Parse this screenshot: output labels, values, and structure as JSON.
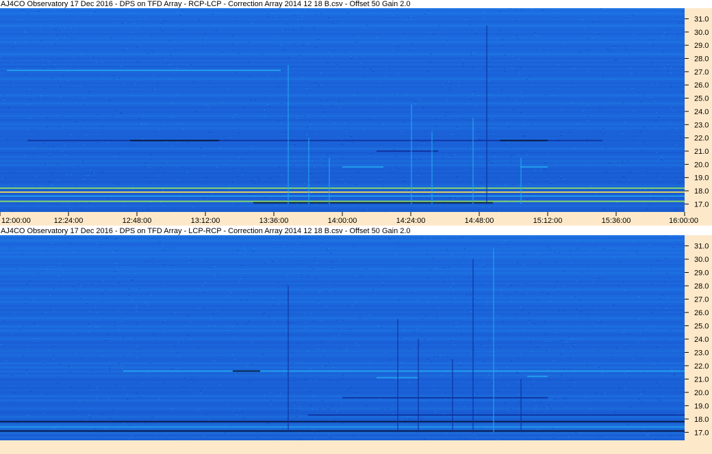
{
  "window": {
    "background": "#ffffff",
    "axis_background": "#fde9c9"
  },
  "colors": {
    "plot_base_top": "#1c6ae0",
    "plot_base_bottom": "#1a5fd6",
    "band_dark": "#0d2f9c",
    "band_light": "#24a8f0",
    "hot_green": "#9cf25a",
    "hot_yellow": "#ffe14a",
    "cold_black": "#061030"
  },
  "chart_data": [
    {
      "type": "heatmap",
      "title": "AJ4CO Observatory 17 Dec 2016  -  DPS on TFD Array  -  RCP-LCP  -  Correction Array 2014 12 18 B.csv  -  Offset 50  Gain 2.0",
      "xlabel": "",
      "ylabel": "",
      "x_ticks": [
        "12:00:00",
        "12:24:00",
        "12:48:00",
        "13:12:00",
        "13:36:00",
        "14:00:00",
        "14:24:00",
        "14:48:00",
        "15:12:00",
        "15:36:00",
        "16:00:00"
      ],
      "y_ticks": [
        "31.0",
        "30.0",
        "29.0",
        "28.0",
        "27.0",
        "26.0",
        "25.0",
        "24.0",
        "23.0",
        "22.0",
        "21.0",
        "20.0",
        "19.0",
        "18.0",
        "17.0"
      ],
      "xlim": [
        "12:00:00",
        "16:00:00"
      ],
      "ylim": [
        16.4,
        31.8
      ],
      "features": [
        {
          "kind": "hline",
          "freq": 21.8,
          "t0": 0.04,
          "t1": 0.88,
          "tone": "dark"
        },
        {
          "kind": "hline",
          "freq": 21.8,
          "t0": 0.19,
          "t1": 0.32,
          "tone": "cold"
        },
        {
          "kind": "hline",
          "freq": 21.8,
          "t0": 0.73,
          "t1": 0.8,
          "tone": "cold"
        },
        {
          "kind": "hline",
          "freq": 21.0,
          "t0": 0.55,
          "t1": 0.64,
          "tone": "dark"
        },
        {
          "kind": "hline",
          "freq": 19.8,
          "t0": 0.5,
          "t1": 0.56,
          "tone": "light"
        },
        {
          "kind": "hline",
          "freq": 19.8,
          "t0": 0.76,
          "t1": 0.8,
          "tone": "light"
        },
        {
          "kind": "hline",
          "freq": 18.2,
          "t0": 0.0,
          "t1": 1.0,
          "tone": "green"
        },
        {
          "kind": "hline",
          "freq": 17.9,
          "t0": 0.0,
          "t1": 1.0,
          "tone": "yellow"
        },
        {
          "kind": "hline",
          "freq": 17.6,
          "t0": 0.0,
          "t1": 1.0,
          "tone": "light"
        },
        {
          "kind": "hline",
          "freq": 17.2,
          "t0": 0.0,
          "t1": 1.0,
          "tone": "green"
        },
        {
          "kind": "hline",
          "freq": 17.1,
          "t0": 0.37,
          "t1": 0.72,
          "tone": "cold"
        },
        {
          "kind": "hline",
          "freq": 27.1,
          "t0": 0.01,
          "t1": 0.41,
          "tone": "light"
        },
        {
          "kind": "vburst",
          "t": 0.42,
          "f0": 17.0,
          "f1": 27.5,
          "tone": "light"
        },
        {
          "kind": "vburst",
          "t": 0.45,
          "f0": 17.0,
          "f1": 22.0,
          "tone": "light"
        },
        {
          "kind": "vburst",
          "t": 0.48,
          "f0": 17.0,
          "f1": 20.5,
          "tone": "light"
        },
        {
          "kind": "vburst",
          "t": 0.6,
          "f0": 17.0,
          "f1": 24.5,
          "tone": "light"
        },
        {
          "kind": "vburst",
          "t": 0.63,
          "f0": 17.0,
          "f1": 22.5,
          "tone": "light"
        },
        {
          "kind": "vburst",
          "t": 0.69,
          "f0": 17.0,
          "f1": 23.5,
          "tone": "light"
        },
        {
          "kind": "vburst",
          "t": 0.71,
          "f0": 17.0,
          "f1": 30.5,
          "tone": "dark"
        },
        {
          "kind": "vburst",
          "t": 0.76,
          "f0": 17.0,
          "f1": 20.5,
          "tone": "light"
        }
      ]
    },
    {
      "type": "heatmap",
      "title": "AJ4CO Observatory 17 Dec 2016  -  DPS on TFD Array  -  LCP-RCP  -  Correction Array 2014 12 18 B.csv  -  Offset 50  Gain 2.0",
      "xlabel": "",
      "ylabel": "",
      "x_ticks": [],
      "y_ticks": [
        "31.0",
        "30.0",
        "29.0",
        "28.0",
        "27.0",
        "26.0",
        "25.0",
        "24.0",
        "23.0",
        "22.0",
        "21.0",
        "20.0",
        "19.0",
        "18.0",
        "17.0"
      ],
      "xlim": [
        "12:00:00",
        "16:00:00"
      ],
      "ylim": [
        16.4,
        31.8
      ],
      "features": [
        {
          "kind": "hline",
          "freq": 21.6,
          "t0": 0.18,
          "t1": 1.0,
          "tone": "light"
        },
        {
          "kind": "hline",
          "freq": 21.6,
          "t0": 0.34,
          "t1": 0.38,
          "tone": "cold"
        },
        {
          "kind": "hline",
          "freq": 21.1,
          "t0": 0.55,
          "t1": 0.61,
          "tone": "light"
        },
        {
          "kind": "hline",
          "freq": 21.2,
          "t0": 0.77,
          "t1": 0.8,
          "tone": "light"
        },
        {
          "kind": "hline",
          "freq": 19.6,
          "t0": 0.5,
          "t1": 0.8,
          "tone": "dark"
        },
        {
          "kind": "hline",
          "freq": 18.3,
          "t0": 0.45,
          "t1": 1.0,
          "tone": "dark"
        },
        {
          "kind": "hline",
          "freq": 17.8,
          "t0": 0.0,
          "t1": 1.0,
          "tone": "cold"
        },
        {
          "kind": "hline",
          "freq": 17.4,
          "t0": 0.0,
          "t1": 1.0,
          "tone": "light"
        },
        {
          "kind": "hline",
          "freq": 17.1,
          "t0": 0.0,
          "t1": 1.0,
          "tone": "cold"
        },
        {
          "kind": "vburst",
          "t": 0.42,
          "f0": 17.0,
          "f1": 28.0,
          "tone": "dark"
        },
        {
          "kind": "vburst",
          "t": 0.58,
          "f0": 17.0,
          "f1": 25.5,
          "tone": "dark"
        },
        {
          "kind": "vburst",
          "t": 0.61,
          "f0": 17.0,
          "f1": 24.0,
          "tone": "dark"
        },
        {
          "kind": "vburst",
          "t": 0.66,
          "f0": 17.0,
          "f1": 22.5,
          "tone": "dark"
        },
        {
          "kind": "vburst",
          "t": 0.69,
          "f0": 17.0,
          "f1": 30.0,
          "tone": "dark"
        },
        {
          "kind": "vburst",
          "t": 0.72,
          "f0": 17.0,
          "f1": 30.8,
          "tone": "light"
        },
        {
          "kind": "vburst",
          "t": 0.76,
          "f0": 17.0,
          "f1": 21.0,
          "tone": "dark"
        }
      ]
    }
  ]
}
